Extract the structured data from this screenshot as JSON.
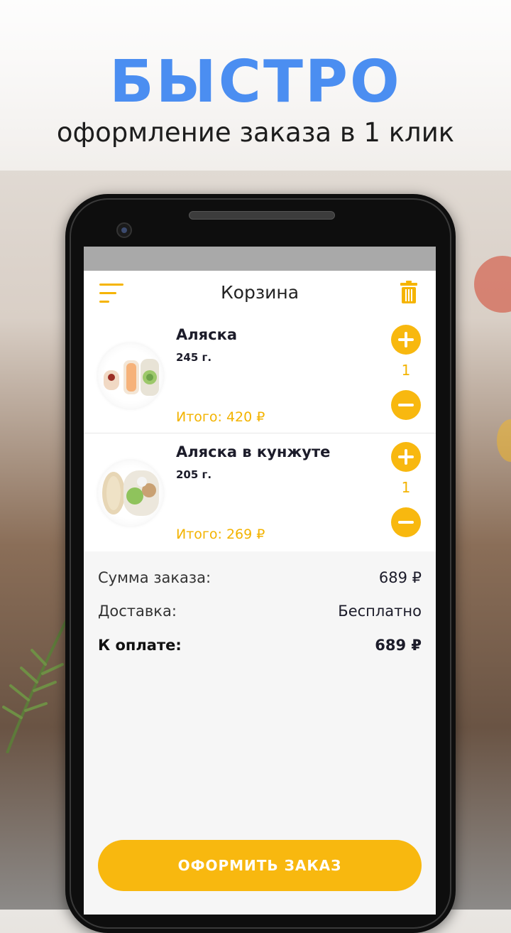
{
  "promo": {
    "headline": "БЫСТРО",
    "subline": "оформление заказа в 1 клик"
  },
  "appbar": {
    "title": "Корзина",
    "menu_icon": "menu-icon",
    "trash_icon": "trash-icon"
  },
  "cart": {
    "items": [
      {
        "name": "Аляска",
        "weight": "245 г.",
        "total": "Итого: 420 ₽",
        "quantity": "1"
      },
      {
        "name": "Аляска в кунжуте",
        "weight": "205 г.",
        "total": "Итого: 269 ₽",
        "quantity": "1"
      }
    ]
  },
  "summary": {
    "order_sum_label": "Сумма заказа:",
    "order_sum_value": "689 ₽",
    "delivery_label": "Доставка:",
    "delivery_value": "Бесплатно",
    "to_pay_label": "К оплате:",
    "to_pay_value": "689 ₽"
  },
  "checkout": {
    "label": "ОФОРМИТЬ ЗАКАЗ"
  },
  "colors": {
    "accent": "#f8b80f",
    "headline_blue": "#4b8ef1",
    "text_dark": "#1c1c2a"
  }
}
